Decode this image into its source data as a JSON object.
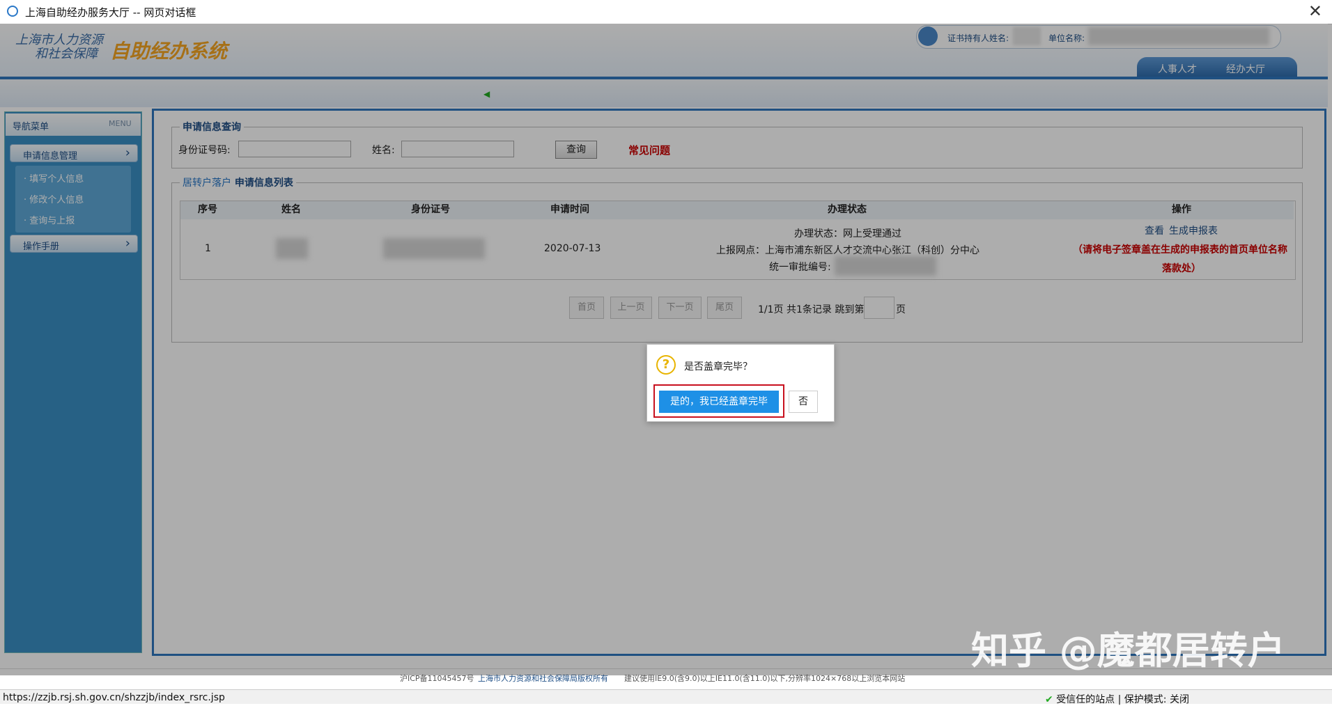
{
  "window": {
    "title": "上海自助经办服务大厅 -- 网页对话框",
    "close": "✕"
  },
  "banner": {
    "logo_line1": "上海市人力资源",
    "logo_line2": "和社会保障",
    "logo_system": "自助经办系统",
    "cert_holder_label": "证书持有人姓名:",
    "unit_label": "单位名称:",
    "tab1": "人事人才",
    "tab2": "经办大厅"
  },
  "sidebar": {
    "header": "导航菜单",
    "header_en": "MENU",
    "group1": "申请信息管理",
    "items": [
      "填写个人信息",
      "修改个人信息",
      "查询与上报"
    ],
    "group2": "操作手册"
  },
  "query": {
    "legend": "申请信息查询",
    "id_label": "身份证号码:",
    "name_label": "姓名:",
    "query_button": "查询",
    "faq": "常见问题"
  },
  "list": {
    "legend_prefix": "居转户落户",
    "legend_suffix": "申请信息列表",
    "columns": [
      "序号",
      "姓名",
      "身份证号",
      "申请时间",
      "办理状态",
      "操作"
    ],
    "rows": [
      {
        "index": "1",
        "date": "2020-07-13",
        "status_line1": "办理状态：网上受理通过",
        "status_line2": "上报网点：上海市浦东新区人才交流中心张江（科创）分中心",
        "status_line3": "统一审批编号:",
        "action_view": "查看",
        "action_generate": "生成申报表",
        "note_line1": "（请将电子签章盖在生成的申报表的首页单位名称",
        "note_line2": "落款处）"
      }
    ]
  },
  "pagination": {
    "first": "首页",
    "prev": "上一页",
    "next": "下一页",
    "last": "尾页",
    "info": "1/1页 共1条记录 跳到第",
    "suffix": "页"
  },
  "dialog": {
    "message": "是否盖章完毕？",
    "yes": "是的，我已经盖章完毕",
    "no": "否"
  },
  "footer": {
    "icp": "沪ICP备11045457号",
    "copyright": "上海市人力资源和社会保障局版权所有",
    "advice": "建议使用IE9.0(含9.0)以上IE11.0(含11.0)以下,分辨率1024×768以上浏览本网站"
  },
  "statusbar": {
    "url": "https://zzjb.rsj.sh.gov.cn/shzzjb/index_rsrc.jsp",
    "trust": "受信任的站点 | 保护模式: 关闭"
  },
  "watermark": "知乎 @魔都居转户",
  "colors": {
    "accent": "#2f76bf",
    "button_blue": "#1e90e6",
    "alert_red": "#c8101e"
  }
}
